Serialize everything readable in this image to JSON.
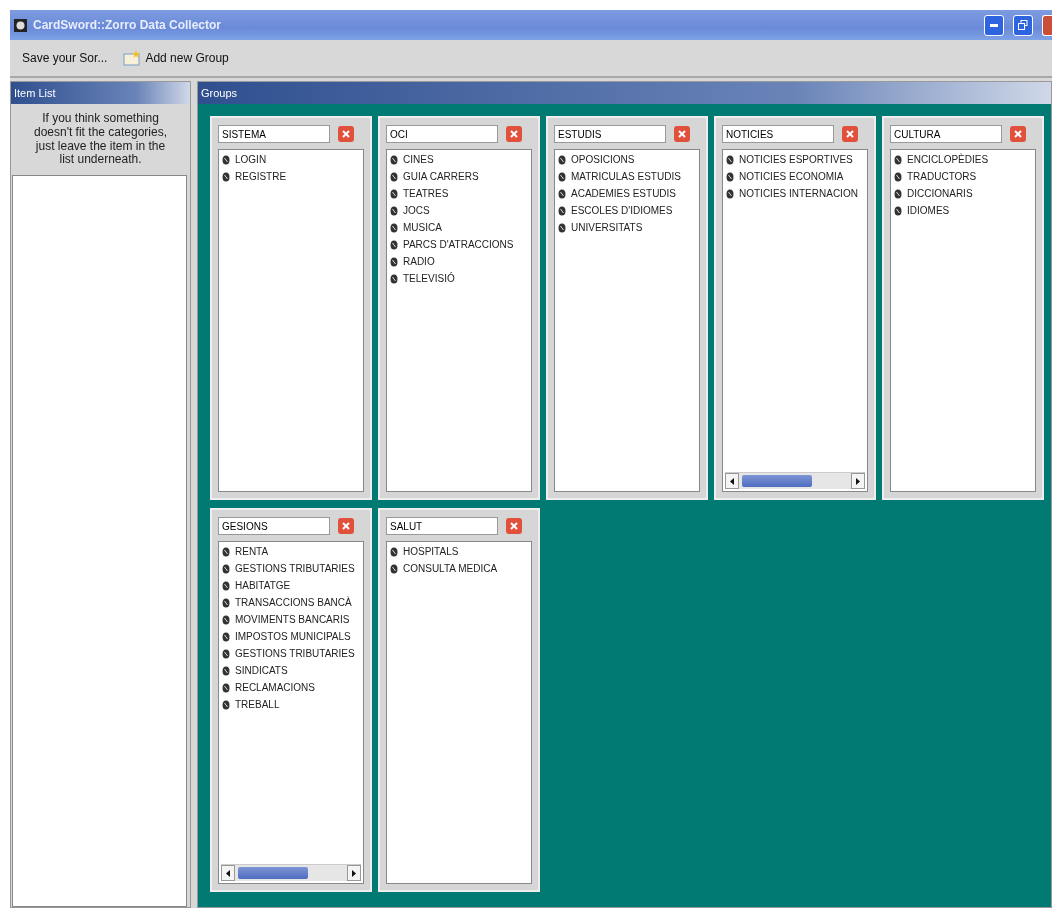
{
  "window": {
    "title": "CardSword::Zorro Data Collector"
  },
  "toolbar": [
    "Save your Sor...",
    "Add new Group"
  ],
  "item_list": {
    "title": "Item List",
    "hint": "If you think something doesn't fit the categories, just leave the item in the list underneath."
  },
  "groups_panel": {
    "title": "Groups",
    "groups": [
      {
        "name": "SISTEMA",
        "scrollbar": false,
        "items": [
          "LOGIN",
          "REGISTRE"
        ]
      },
      {
        "name": "OCI",
        "scrollbar": false,
        "items": [
          "CINES",
          "GUIA CARRERS",
          "TEATRES",
          "JOCS",
          "MUSICA",
          "PARCS D'ATRACCIONS",
          "RADIO",
          "TELEVISIÓ"
        ]
      },
      {
        "name": "ESTUDIS",
        "scrollbar": false,
        "items": [
          "OPOSICIONS",
          "MATRICULAS ESTUDIS",
          "ACADEMIES ESTUDIS",
          "ESCOLES D'IDIOMES",
          "UNIVERSITATS"
        ]
      },
      {
        "name": "NOTICIES",
        "scrollbar": true,
        "items": [
          "NOTICIES ESPORTIVES",
          "NOTICIES ECONOMIA",
          "NOTICIES INTERNACION"
        ]
      },
      {
        "name": "CULTURA",
        "scrollbar": false,
        "items": [
          "ENCICLOPÈDIES",
          "TRADUCTORS",
          "DICCIONARIS",
          "IDIOMES"
        ]
      },
      {
        "name": "GESIONS",
        "scrollbar": true,
        "items": [
          "RENTA",
          "GESTIONS TRIBUTARIES",
          "HABITATGE",
          "TRANSACCIONS BANCÀ",
          "MOVIMENTS BANCARIS",
          "IMPOSTOS MUNICIPALS",
          "GESTIONS TRIBUTARIES",
          "SINDICATS",
          "RECLAMACIONS",
          "TREBALL"
        ]
      },
      {
        "name": "SALUT",
        "scrollbar": false,
        "items": [
          "HOSPITALS",
          "CONSULTA MEDICA"
        ]
      }
    ]
  }
}
